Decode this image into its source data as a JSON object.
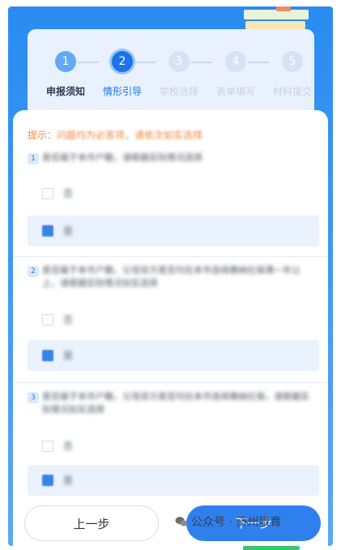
{
  "steps": [
    {
      "num": "1",
      "label": "申报须知",
      "state": "done"
    },
    {
      "num": "2",
      "label": "情形引导",
      "state": "active"
    },
    {
      "num": "3",
      "label": "学校选择",
      "state": "pending"
    },
    {
      "num": "4",
      "label": "表单填写",
      "state": "pending"
    },
    {
      "num": "5",
      "label": "材料提交",
      "state": "pending"
    }
  ],
  "tip": {
    "prefix": "提示：",
    "text": "问题均为必答项，请依次如实选择"
  },
  "questions": [
    {
      "num": "1",
      "text": "是否属于本市户籍，请根据实际情况选择",
      "options": [
        "否",
        "是"
      ],
      "selected": 1
    },
    {
      "num": "2",
      "text": "是否属于本市户籍，父母双方是否均在本市连续缴纳社保满一年以上，请根据实际情况如实选择",
      "options": [
        "否",
        "是"
      ],
      "selected": 1
    },
    {
      "num": "3",
      "text": "是否属于本市户籍，父母双方是否均在本市连续缴纳社保，请根据实际情况如实选择",
      "options": [
        "否",
        "是"
      ],
      "selected": 1
    }
  ],
  "buttons": {
    "prev": "上一步",
    "next": "下一步"
  },
  "watermark": "公众号 · 济州教育",
  "colors": {
    "primary": "#2f80ed",
    "header_bg": "#3b97f4",
    "tip": "#f08a3c",
    "selected_bg": "#eaf2fd"
  }
}
